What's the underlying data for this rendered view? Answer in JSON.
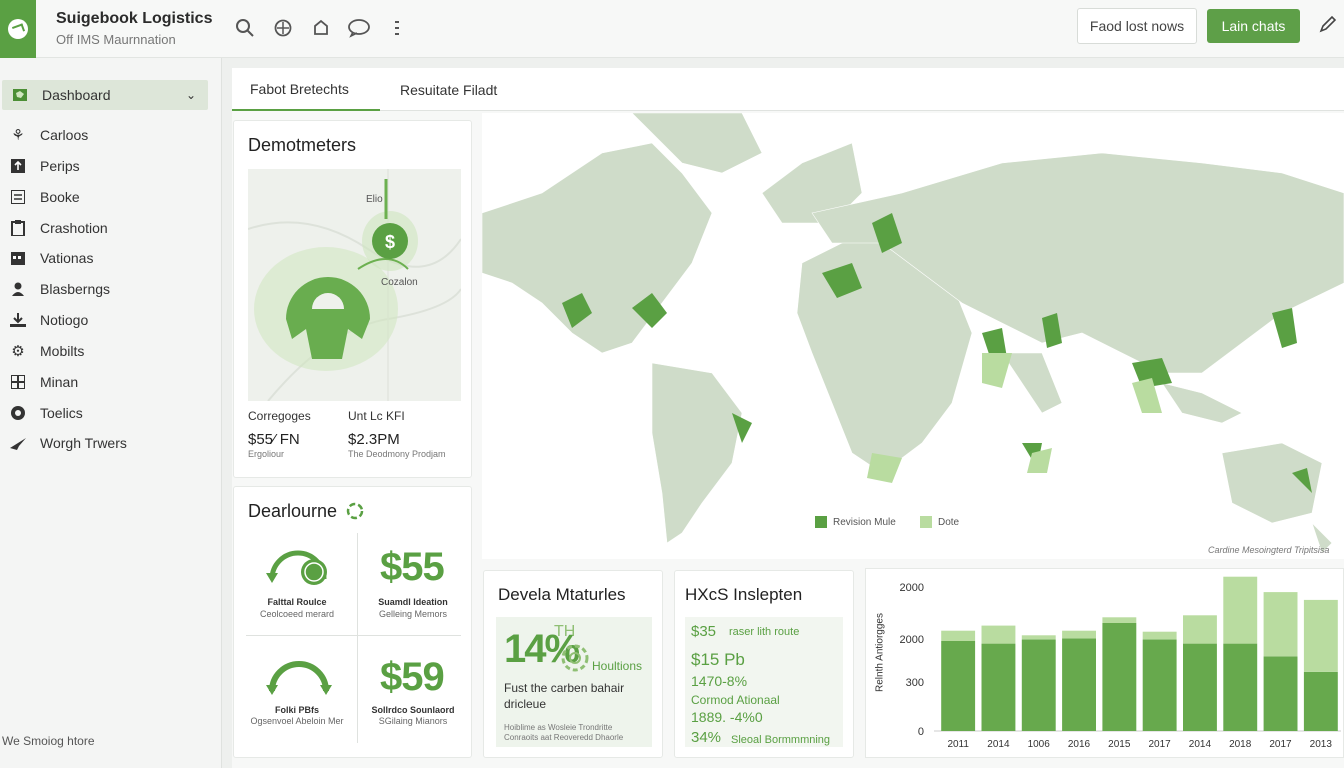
{
  "header": {
    "title": "Suigebook Logistics",
    "subtitle": "Off IMS Maurnnation",
    "btn_secondary": "Faod lost nows",
    "btn_primary": "Lain chats"
  },
  "sidebar": {
    "items": [
      {
        "label": "Dashboard",
        "icon": "map-icon",
        "active": true
      },
      {
        "label": "Carloos",
        "icon": "plant-icon"
      },
      {
        "label": "Perips",
        "icon": "upload-icon"
      },
      {
        "label": "Booke",
        "icon": "book-icon"
      },
      {
        "label": "Crashotion",
        "icon": "clipboard-icon"
      },
      {
        "label": "Vationas",
        "icon": "calendar-icon"
      },
      {
        "label": "Blasberngs",
        "icon": "user-icon"
      },
      {
        "label": "Notiogo",
        "icon": "download-icon"
      },
      {
        "label": "Mobilts",
        "icon": "gear-icon"
      },
      {
        "label": "Minan",
        "icon": "grid-icon"
      },
      {
        "label": "Toelics",
        "icon": "globe-icon"
      },
      {
        "label": "Worgh Trwers",
        "icon": "plane-icon"
      }
    ],
    "footer": "We Smoiog htore"
  },
  "tabs": [
    "Fabot Bretechts",
    "Resuitate Filadt"
  ],
  "demo_card": {
    "title": "Demotmeters",
    "map_label_1": "Elio",
    "map_label_2": "Cozalon",
    "col1_label": "Corregoges",
    "col1_value": "$55⁄ FN",
    "col1_sub": "Ergoliour",
    "col2_label": "Unt Lc KFI",
    "col2_value": "$2.3PM",
    "col2_sub": "The Deodmony Prodjam"
  },
  "dear_card": {
    "title": "Dearlourne",
    "kpis": [
      {
        "label": "Falttal Roulce",
        "sub": "Ceolcoeed merard"
      },
      {
        "value": "$55",
        "label": "Suamdl Ideation",
        "sub": "Gelleing Memors"
      },
      {
        "label": "Folki PBfs",
        "sub": "Ogsenvoel Abeloin Mer"
      },
      {
        "value": "$59",
        "label": "Sollrdco Sounlaord",
        "sub": "SGilaing Mianors"
      }
    ]
  },
  "map": {
    "legend": [
      {
        "label": "Revision Mule",
        "color": "#5aa043"
      },
      {
        "label": "Dote",
        "color": "#b9dca0"
      }
    ],
    "caption": "Cardine Mesoingterd Tripitsisa"
  },
  "devela_card": {
    "title": "Devela Mtaturles",
    "big": "14%",
    "big_suffix": "TH",
    "side": "Houltions",
    "line1": "Fust the carben bahair",
    "line2": "dricleue",
    "foot1": "Hoiblime as Wosleie Trondritte",
    "foot2": "Conraoits aat Reoveredd Dhaorle"
  },
  "hxcb_card": {
    "title": "HXcS Inslepten",
    "rows": [
      {
        "a": "$35",
        "b": "raser lith route"
      },
      {
        "a": "$15 Pb",
        "b": ""
      },
      {
        "a": "1470-8%",
        "b": ""
      },
      {
        "a": "Cormod Ationaal",
        "b": ""
      },
      {
        "a": "1889. -4%0",
        "b": ""
      },
      {
        "a": "34%",
        "b": "Sleoal Bormmmning"
      }
    ]
  },
  "chart_data": {
    "type": "bar",
    "ylabel": "Relnth Antiorgges",
    "yticks": [
      "2000",
      "2000",
      "300",
      "0"
    ],
    "categories": [
      "2011",
      "2014",
      "1006",
      "2016",
      "2015",
      "2017",
      "2014",
      "2018",
      "2017",
      "2013"
    ],
    "series": [
      {
        "name": "",
        "color": "#67a94d",
        "values": [
          1750,
          1700,
          1780,
          1800,
          2100,
          1780,
          1700,
          1700,
          1450,
          1150
        ]
      },
      {
        "name": "",
        "color": "#b9dca0",
        "values": [
          200,
          350,
          80,
          150,
          110,
          150,
          550,
          1300,
          1250,
          1400
        ]
      }
    ],
    "ylim": [
      0,
      2800
    ]
  }
}
